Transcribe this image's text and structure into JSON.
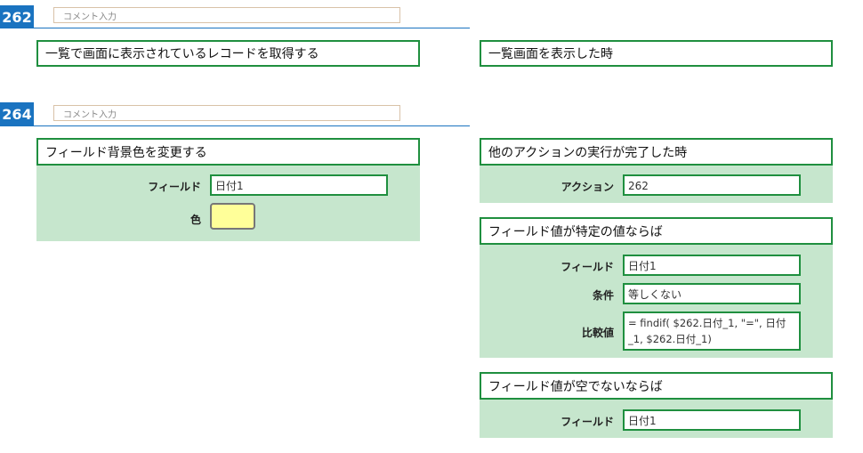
{
  "rows": [
    {
      "number": "262",
      "comment_placeholder": "コメント入力",
      "action": {
        "title": "一覧で画面に表示されているレコードを取得する"
      },
      "triggers": [
        {
          "title": "一覧画面を表示した時"
        }
      ]
    },
    {
      "number": "264",
      "comment_placeholder": "コメント入力",
      "action": {
        "title": "フィールド背景色を変更する",
        "field_label": "フィールド",
        "field_value": "日付1",
        "color_label": "色",
        "color_value": "#ffff99"
      },
      "triggers": [
        {
          "title": "他のアクションの実行が完了した時",
          "action_label": "アクション",
          "action_value": "262"
        },
        {
          "title": "フィールド値が特定の値ならば",
          "field_label": "フィールド",
          "field_value": "日付1",
          "condition_label": "条件",
          "condition_value": "等しくない",
          "compare_label": "比較値",
          "compare_value": "= findif( $262.日付_1, \"=\", 日付_1, $262.日付_1)"
        },
        {
          "title": "フィールド値が空でないならば",
          "field_label": "フィールド",
          "field_value": "日付1"
        }
      ]
    }
  ],
  "colors": {
    "row_number_bg": "#1a73c0",
    "block_border": "#1f8f3f",
    "block_body_bg": "#c6e6cd",
    "comment_border": "#d9c2a8"
  }
}
